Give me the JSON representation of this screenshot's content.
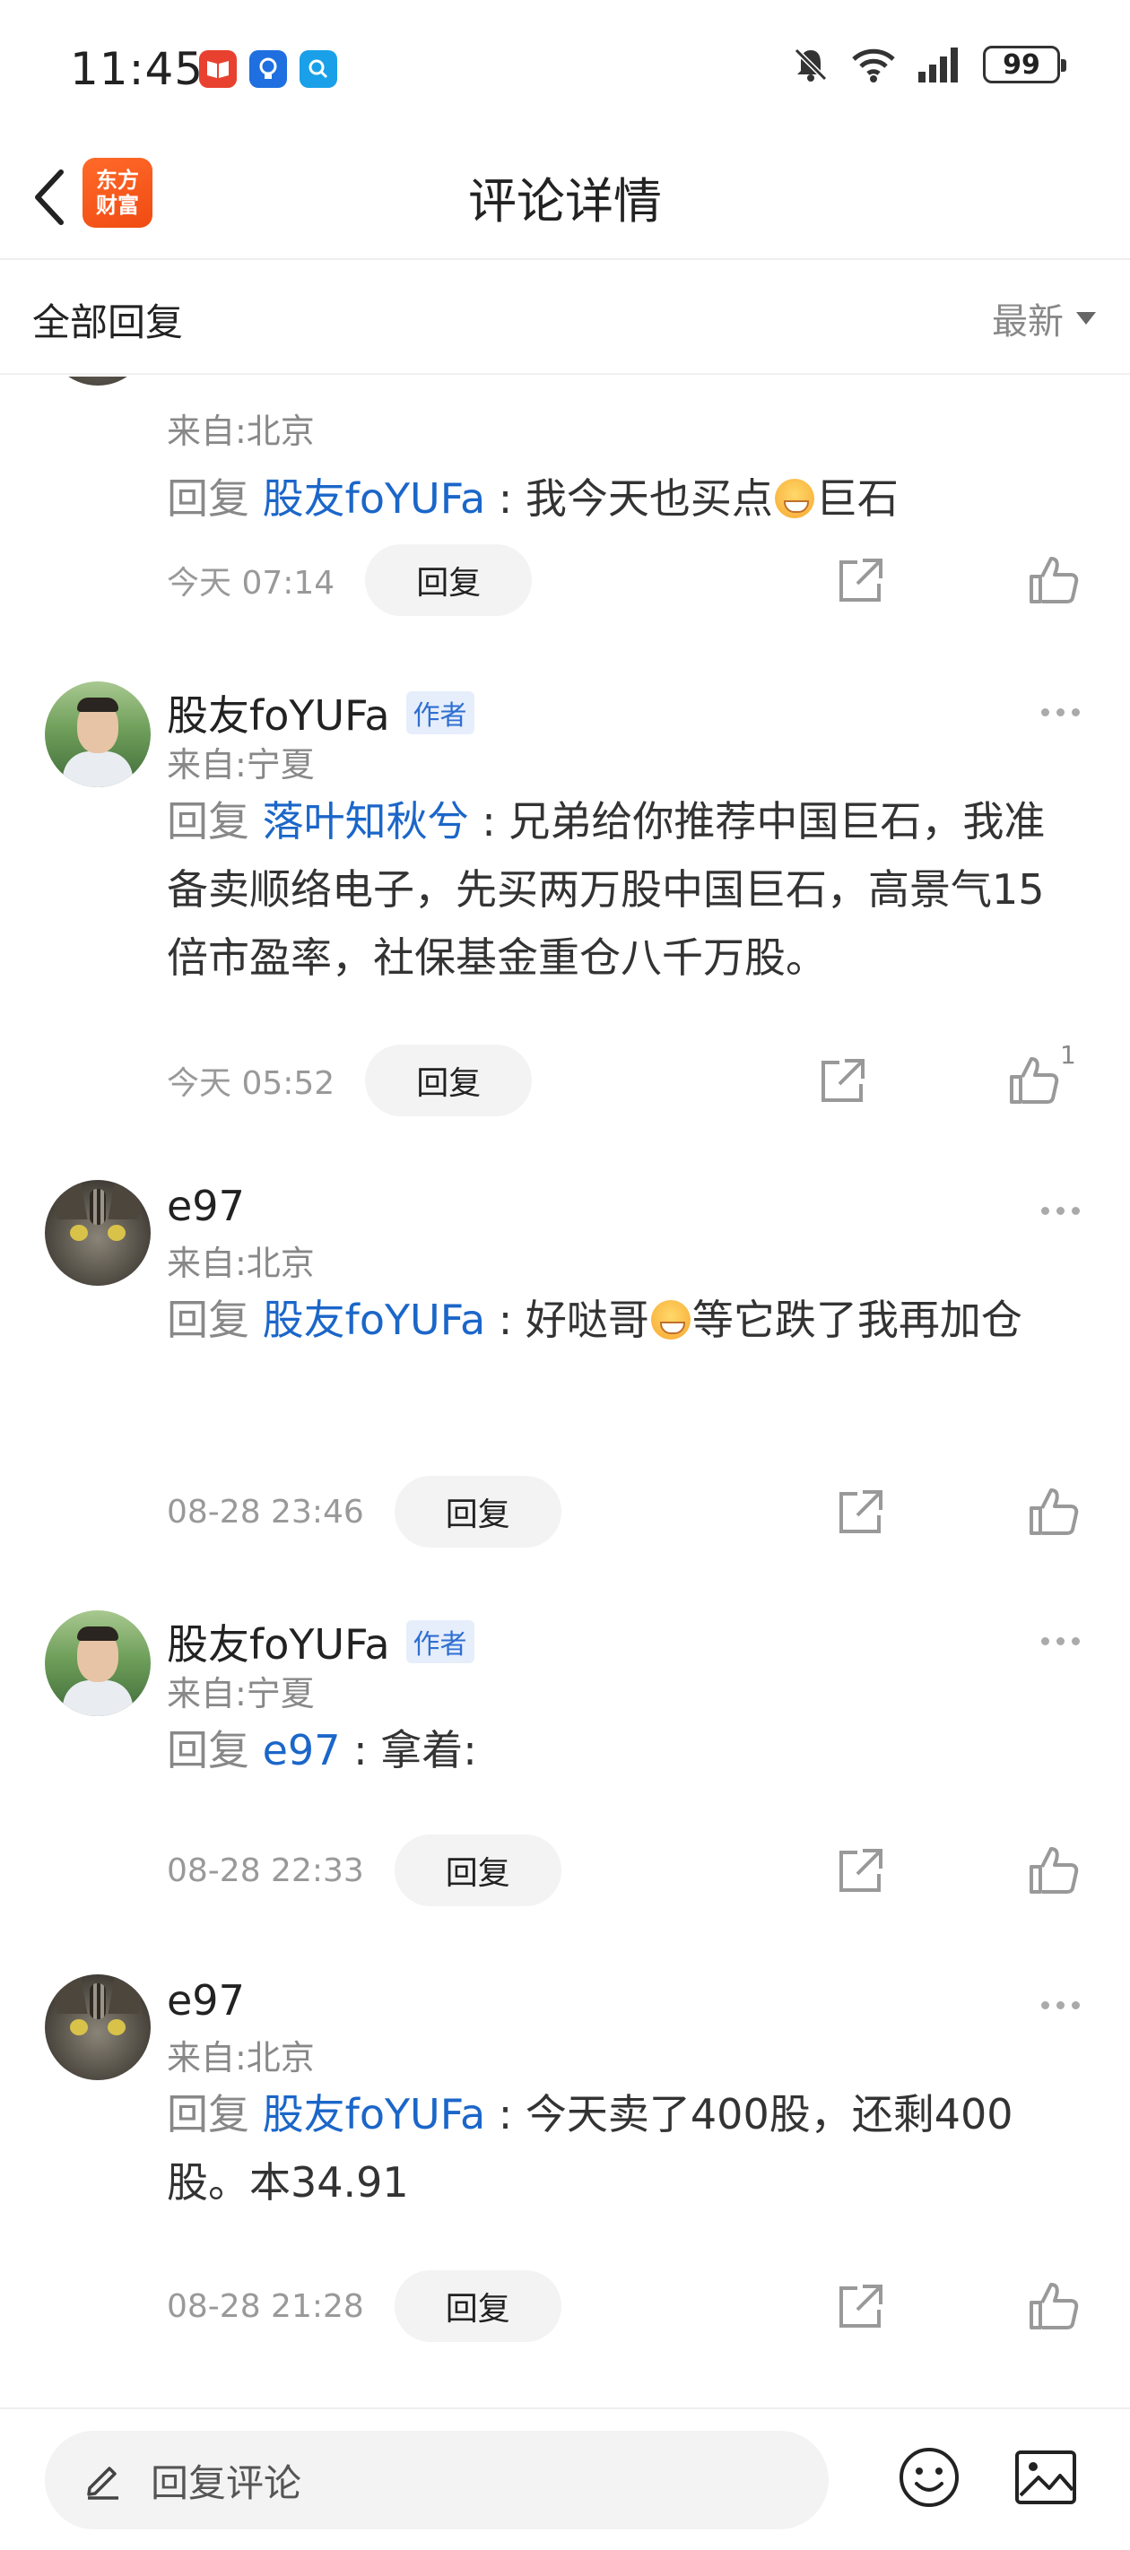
{
  "status_bar": {
    "time": "11:45",
    "battery": "99"
  },
  "header": {
    "logo_line1": "东方",
    "logo_line2": "财富",
    "title": "评论详情"
  },
  "sort_bar": {
    "label": "全部回复",
    "sort_option": "最新"
  },
  "comments": [
    {
      "loc": "来自:北京",
      "reply_word": "回复",
      "reply_target": "股友foYUFa",
      "colon": " : ",
      "text_a": "我今天也买点",
      "text_b": "巨石",
      "time": "今天 07:14",
      "reply_btn": "回复"
    },
    {
      "name": "股友foYUFa",
      "badge": "作者",
      "loc": "来自:宁夏",
      "reply_word": "回复",
      "reply_target": "落叶知秋兮",
      "colon": " : ",
      "text": "兄弟给你推荐中国巨石，我准备卖顺络电子，先买两万股中国巨石，高景气15倍市盈率，社保基金重仓八千万股。",
      "time": "今天 05:52",
      "reply_btn": "回复",
      "like_count": "1"
    },
    {
      "name": "e97",
      "loc": "来自:北京",
      "reply_word": "回复",
      "reply_target": "股友foYUFa",
      "colon": " : ",
      "text_a": "好哒哥",
      "text_b": "等它跌了我再加仓",
      "time": "08-28 23:46",
      "reply_btn": "回复"
    },
    {
      "name": "股友foYUFa",
      "badge": "作者",
      "loc": "来自:宁夏",
      "reply_word": "回复",
      "reply_target": "e97",
      "colon": " : ",
      "text": "拿着:",
      "time": "08-28 22:33",
      "reply_btn": "回复"
    },
    {
      "name": "e97",
      "loc": "来自:北京",
      "reply_word": "回复",
      "reply_target": "股友foYUFa",
      "colon": " : ",
      "text": "今天卖了400股，还剩400股。本34.91",
      "time": "08-28 21:28",
      "reply_btn": "回复"
    }
  ],
  "bottom_bar": {
    "placeholder": "回复评论"
  },
  "icons": {
    "back": "chevron-left-icon",
    "pencil": "pencil-icon",
    "share": "share-icon",
    "like": "thumbs-up-icon",
    "emoji": "emoji-icon",
    "image": "image-icon"
  },
  "colors": {
    "accent_blue": "#1b66c9",
    "brand_orange": "#f04b12"
  }
}
